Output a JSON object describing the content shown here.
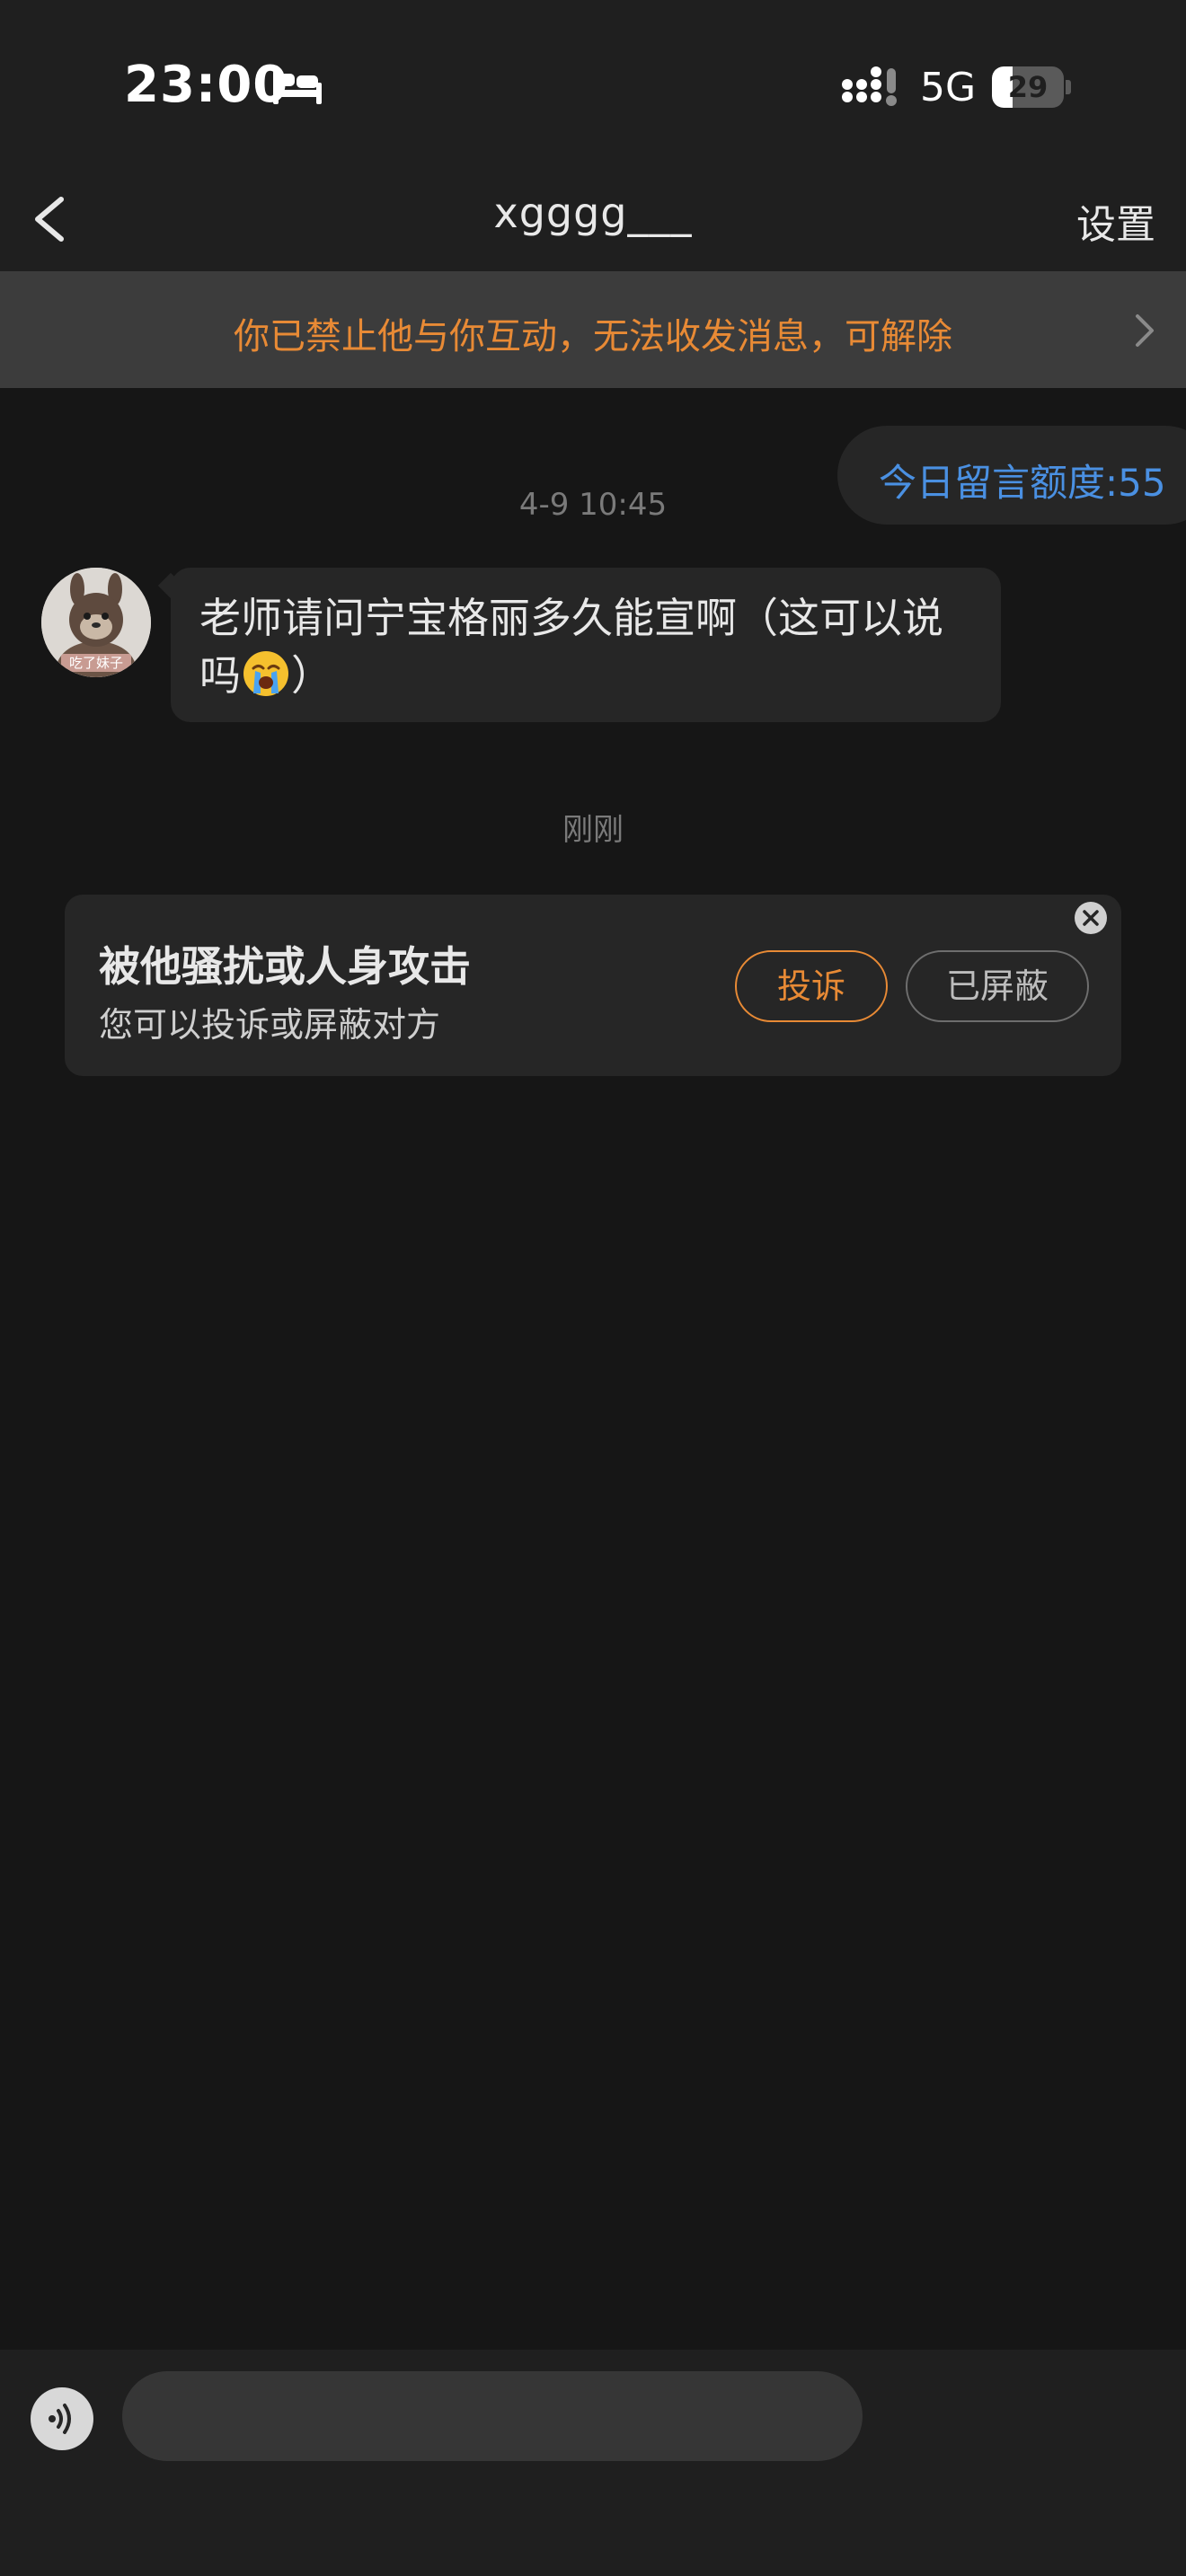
{
  "status_bar": {
    "time": "23:00",
    "network": "5G",
    "battery_level": "29",
    "battery_fraction": 0.29
  },
  "nav": {
    "title": "xgggg___",
    "settings_label": "设置"
  },
  "block_banner": {
    "text": "你已禁止他与你互动，无法收发消息，可解除"
  },
  "quota": {
    "text": "今日留言额度:55"
  },
  "messages": [
    {
      "timestamp": "4-9 10:45",
      "text": "老师请问宁宝格丽多久能宣啊（这可以说吗",
      "text_end": "）",
      "emoji": "loudly-crying-face",
      "avatar_caption": "吃了妹子"
    }
  ],
  "timestamp_recent": "刚刚",
  "report_card": {
    "title": "被他骚扰或人身攻击",
    "subtitle": "您可以投诉或屏蔽对方",
    "complain_label": "投诉",
    "blocked_label": "已屏蔽"
  },
  "composer": {
    "placeholder": ""
  },
  "colors": {
    "accent_orange": "#e88a35",
    "link_blue": "#4a90e2",
    "background": "#161616",
    "surface": "#262626"
  }
}
